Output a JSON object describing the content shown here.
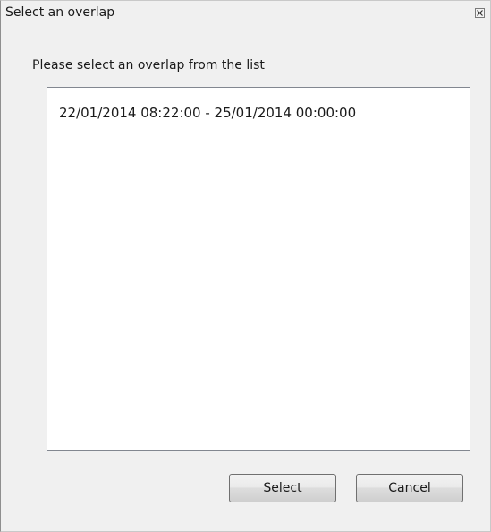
{
  "window": {
    "title": "Select an overlap",
    "close_icon": "close-icon"
  },
  "prompt": "Please select an overlap from the list",
  "list": {
    "items": [
      "22/01/2014 08:22:00 - 25/01/2014 00:00:00"
    ]
  },
  "buttons": {
    "select_label": "Select",
    "cancel_label": "Cancel"
  }
}
